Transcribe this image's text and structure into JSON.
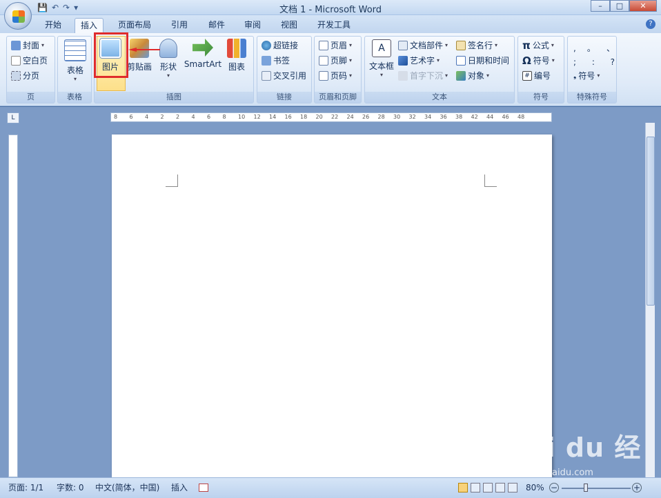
{
  "window": {
    "title": "文档 1 - Microsoft Word"
  },
  "quick_access": [
    "save-icon",
    "undo-icon",
    "redo-icon",
    "customize-icon"
  ],
  "tabs": [
    "开始",
    "插入",
    "页面布局",
    "引用",
    "邮件",
    "审阅",
    "视图",
    "开发工具"
  ],
  "active_tab": "插入",
  "ribbon": {
    "page_group": {
      "label": "页",
      "items": [
        "封面",
        "空白页",
        "分页"
      ]
    },
    "table_group": {
      "label": "表格",
      "button": "表格"
    },
    "illustrations_group": {
      "label": "插图",
      "buttons": [
        "图片",
        "剪贴画",
        "形状",
        "SmartArt",
        "图表"
      ]
    },
    "links_group": {
      "label": "链接",
      "items": [
        "超链接",
        "书签",
        "交叉引用"
      ]
    },
    "header_footer_group": {
      "label": "页眉和页脚",
      "items": [
        "页眉",
        "页脚",
        "页码"
      ]
    },
    "text_group": {
      "label": "文本",
      "big": "文本框",
      "items": [
        "文档部件",
        "艺术字",
        "首字下沉",
        "签名行",
        "日期和时间",
        "对象"
      ]
    },
    "symbols_group": {
      "label": "符号",
      "items": [
        "公式",
        "符号",
        "编号"
      ]
    },
    "special_group": {
      "label": "特殊符号",
      "chars": [
        ",",
        "。",
        "、",
        ";",
        ":",
        "?"
      ],
      "button": "符号"
    }
  },
  "ruler": {
    "ticks": [
      "8",
      "6",
      "4",
      "2",
      "2",
      "4",
      "6",
      "8",
      "10",
      "12",
      "14",
      "16",
      "18",
      "20",
      "22",
      "24",
      "26",
      "28",
      "30",
      "32",
      "34",
      "36",
      "38",
      "42",
      "44",
      "46",
      "48"
    ]
  },
  "statusbar": {
    "page": "页面: 1/1",
    "words": "字数: 0",
    "language": "中文(简体，中国)",
    "mode": "插入",
    "zoom": "80%"
  },
  "watermark": {
    "text": "Bai du 经验",
    "sub": "jingyan.baidu.com"
  },
  "colors": {
    "accent": "#e02b2b",
    "ribbon": "#dfeaf8"
  }
}
